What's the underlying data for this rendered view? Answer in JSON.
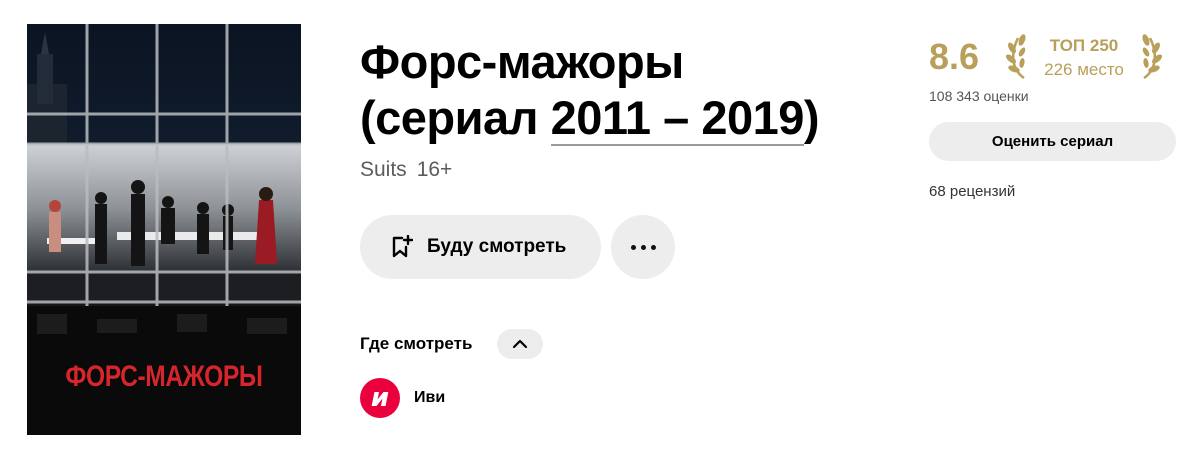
{
  "poster": {
    "title_text": "ФОРС-МАЖОРЫ"
  },
  "title": {
    "main": "Форс-мажоры",
    "prefix": "(сериал ",
    "years": "2011 – 2019",
    "suffix": ")"
  },
  "original": {
    "name": "Suits",
    "age": "16+"
  },
  "actions": {
    "watch_later_label": "Буду смотреть",
    "more_icon": "more-dots-icon"
  },
  "where_to_watch": {
    "label": "Где смотреть",
    "toggle_icon": "chevron-up-icon",
    "services": [
      {
        "name": "Иви",
        "logo_letter": "и"
      }
    ]
  },
  "rating": {
    "score": "8.6",
    "top_label": "ТОП 250",
    "place": "226 место",
    "votes": "108 343 оценки",
    "rate_button": "Оценить сериал",
    "reviews": "68 рецензий"
  },
  "colors": {
    "gold": "#b8a05a",
    "button_bg": "#ededed",
    "ivi_red": "#ea003d",
    "poster_red": "#d6252c"
  }
}
